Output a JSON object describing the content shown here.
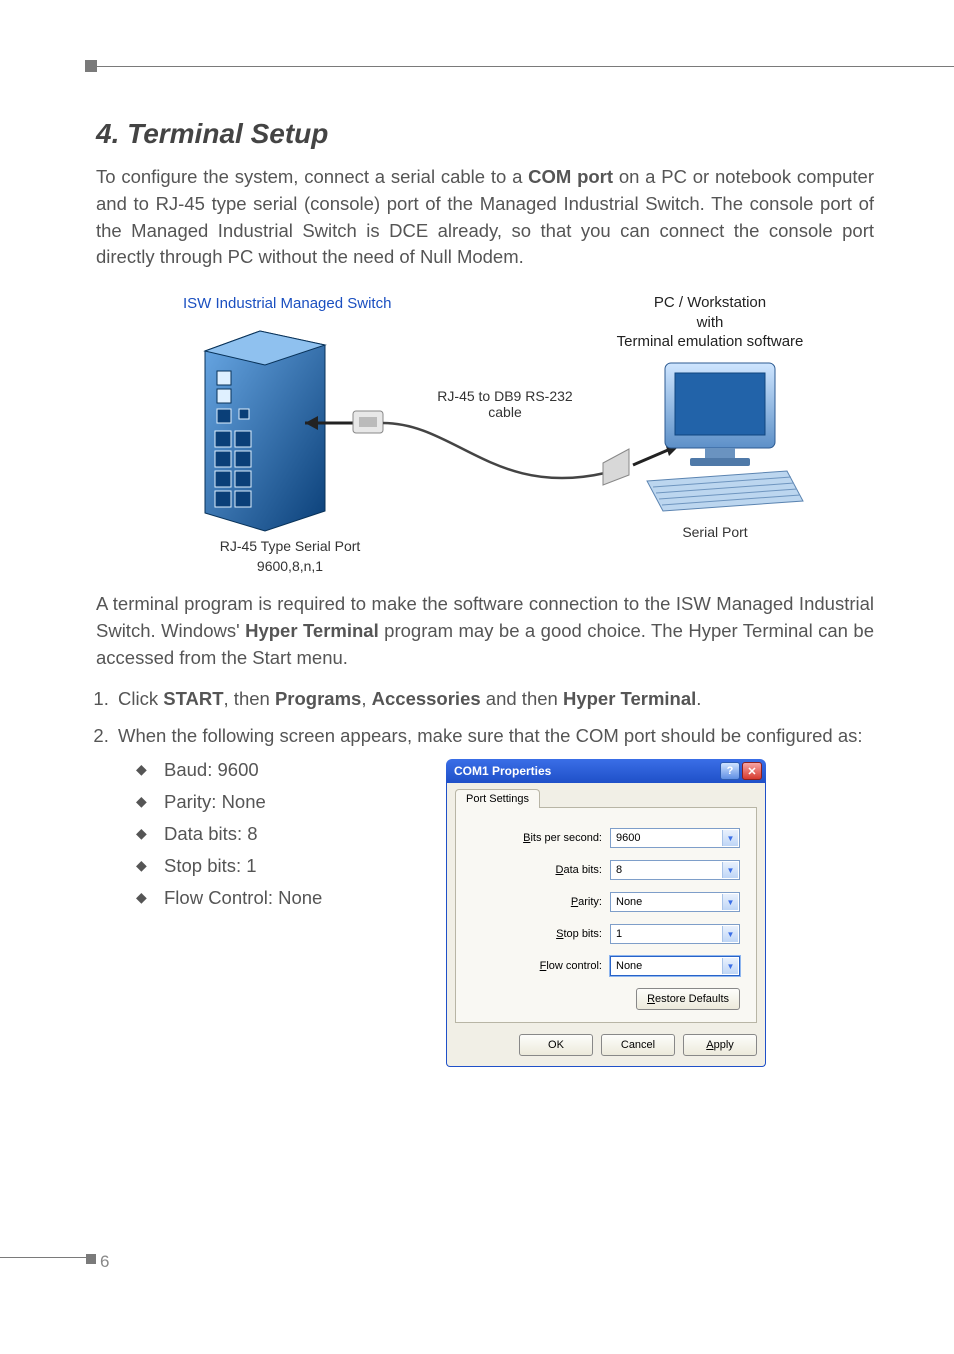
{
  "page_number": "6",
  "heading": "4. Terminal Setup",
  "para1_pre": "To configure the system, connect a serial cable to a ",
  "para1_bold1": "COM port",
  "para1_post": " on a PC or notebook computer and to RJ-45 type serial (console) port of the Managed Industrial Switch. The console port of the Managed Industrial Switch is DCE already, so that you can connect the console port directly through PC without the need of Null Modem.",
  "diagram": {
    "left_title": "ISW Industrial Managed Switch",
    "mid_line1": "RJ-45 to DB9 RS-232",
    "mid_line2": "cable",
    "right_line1": "PC / Workstation",
    "right_line2": "with",
    "right_line3": "Terminal emulation software",
    "left_caption_l1": "RJ-45 Type Serial Port",
    "left_caption_l2": "9600,8,n,1",
    "right_caption": "Serial Port"
  },
  "para2_pre": "A terminal program is required to make the software connection to the ISW Managed Industrial Switch. Windows' ",
  "para2_bold": "Hyper Terminal",
  "para2_post": " program may be a good choice. The Hyper Terminal can be accessed from the Start menu.",
  "step1_parts": [
    "Click ",
    "START",
    ", then ",
    "Programs",
    ", ",
    "Accessories",
    " and then ",
    "Hyper Terminal",
    "."
  ],
  "step2": "When the following screen appears, make sure that the COM port should be configured as:",
  "bullets": [
    "Baud: 9600",
    "Parity: None",
    "Data bits: 8",
    "Stop bits: 1",
    "Flow Control: None"
  ],
  "dialog": {
    "title": "COM1 Properties",
    "tab": "Port Settings",
    "rows": {
      "bps_label": "Bits per second:",
      "bps_value": "9600",
      "data_label": "Data bits:",
      "data_value": "8",
      "parity_label": "Parity:",
      "parity_value": "None",
      "stop_label": "Stop bits:",
      "stop_value": "1",
      "flow_label": "Flow control:",
      "flow_value": "None"
    },
    "restore": "Restore Defaults",
    "ok": "OK",
    "cancel": "Cancel",
    "apply": "Apply"
  }
}
